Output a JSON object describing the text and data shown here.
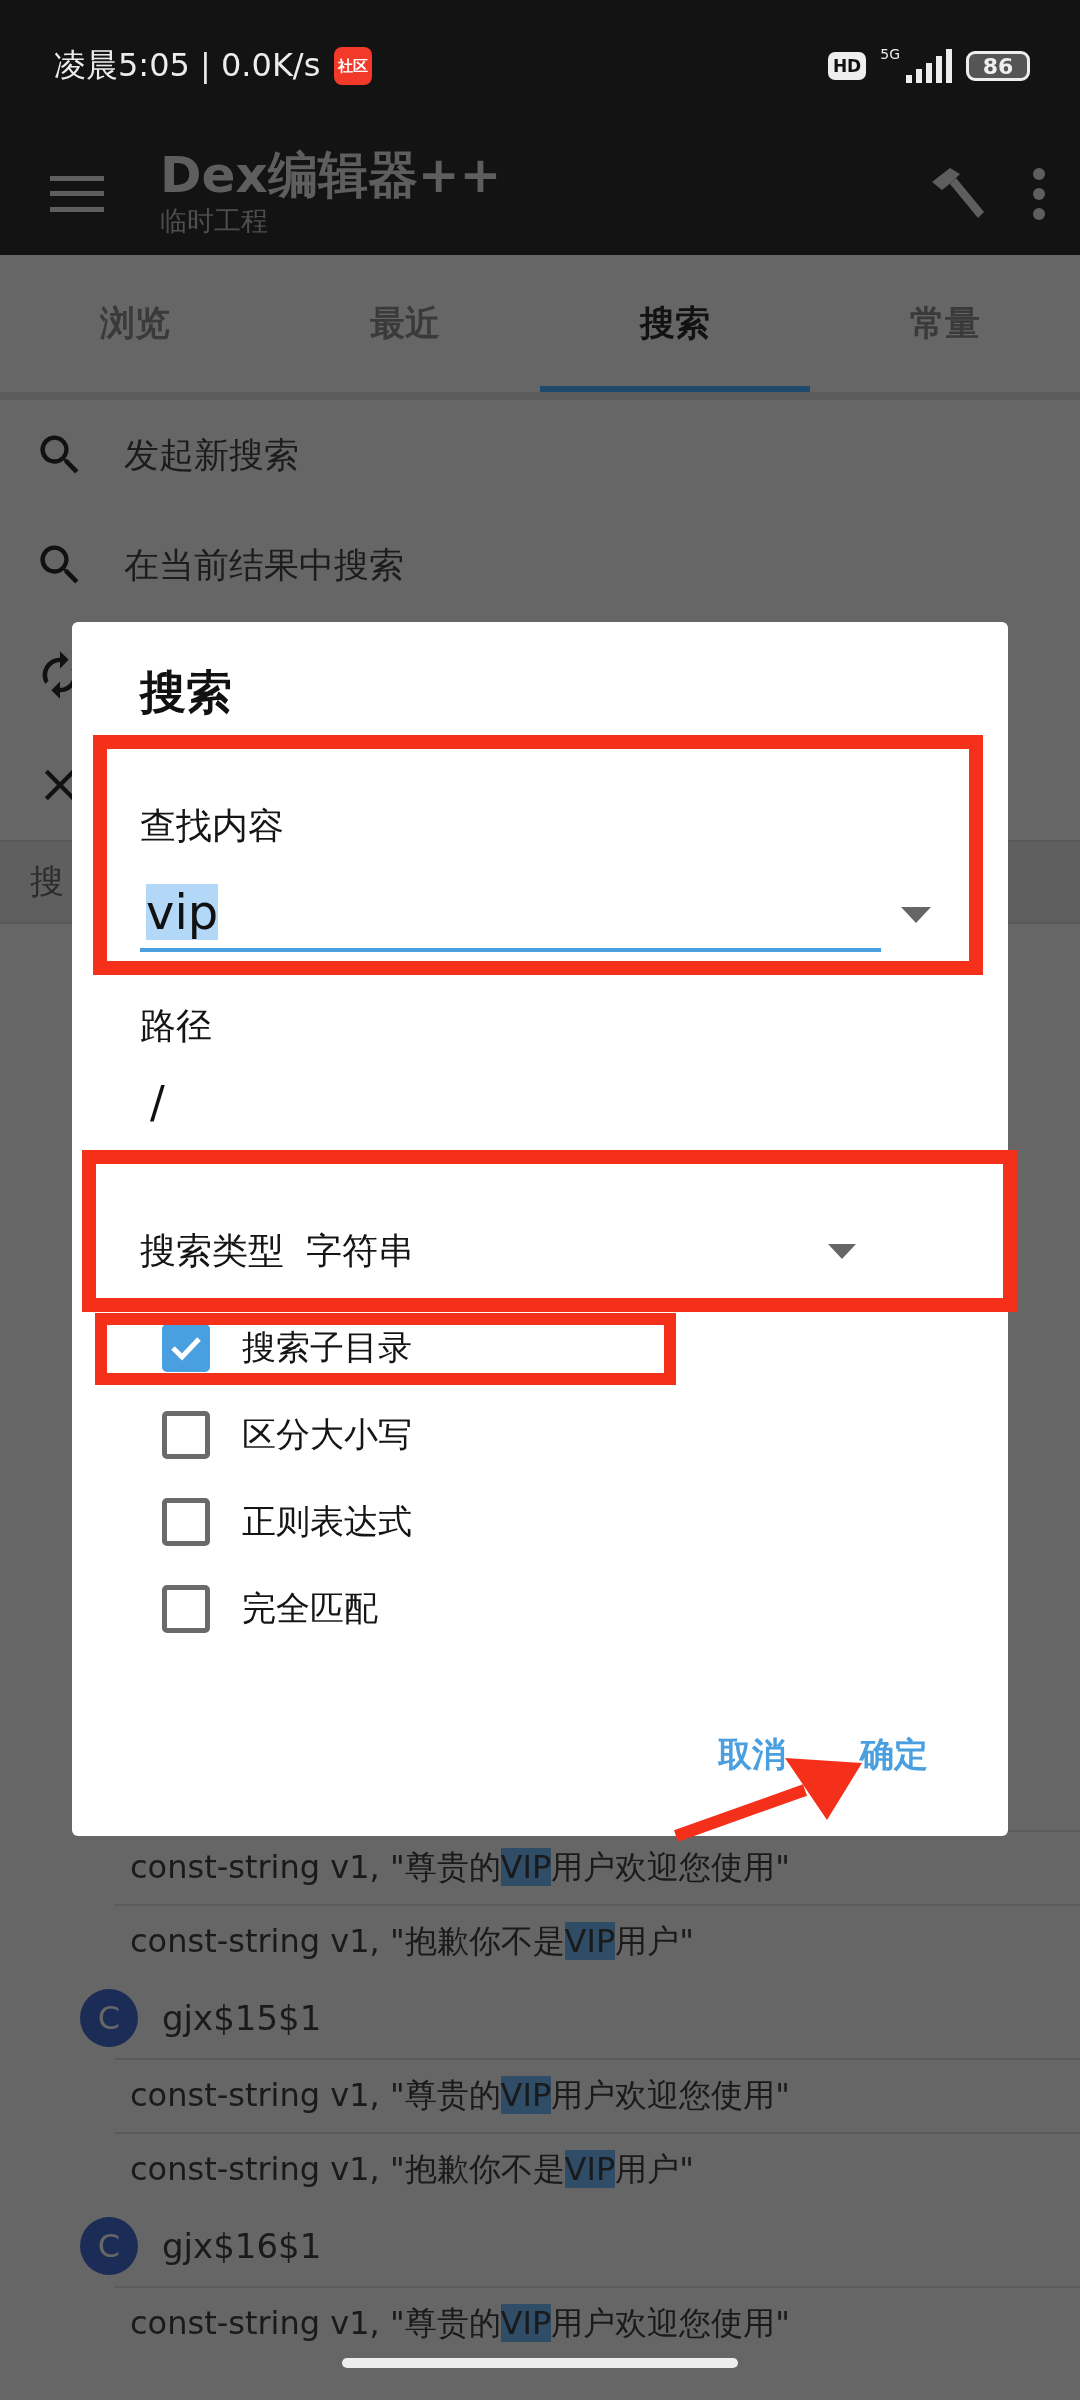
{
  "status_bar": {
    "time": "凌晨5:05 | 0.0K/s",
    "app_badge": "社区",
    "hd": "HD",
    "network": "5G",
    "battery": "86"
  },
  "app_bar": {
    "title": "Dex编辑器++",
    "subtitle": "临时工程"
  },
  "tabs": [
    {
      "label": "浏览",
      "selected": false
    },
    {
      "label": "最近",
      "selected": false
    },
    {
      "label": "搜索",
      "selected": true
    },
    {
      "label": "常量",
      "selected": false
    }
  ],
  "menu": [
    {
      "kind": "search",
      "label": "发起新搜索"
    },
    {
      "kind": "search",
      "label": "在当前结果中搜索"
    },
    {
      "kind": "refresh"
    },
    {
      "kind": "close"
    }
  ],
  "list_header": "搜",
  "results": [
    {
      "kind": "line",
      "before": "const-string v1, \"尊贵的",
      "match": "VIP",
      "after": "用户欢迎您使用\""
    },
    {
      "kind": "line",
      "before": "const-string v1, \"抱歉你不是",
      "match": "VIP",
      "after": "用户\""
    },
    {
      "kind": "class",
      "icon": "C",
      "name": "gjx$15$1"
    },
    {
      "kind": "line",
      "before": "const-string v1, \"尊贵的",
      "match": "VIP",
      "after": "用户欢迎您使用\""
    },
    {
      "kind": "line",
      "before": "const-string v1, \"抱歉你不是",
      "match": "VIP",
      "after": "用户\""
    },
    {
      "kind": "class",
      "icon": "C",
      "name": "gjx$16$1"
    },
    {
      "kind": "line",
      "before": "const-string v1, \"尊贵的",
      "match": "VIP",
      "after": "用户欢迎您使用\""
    }
  ],
  "dialog": {
    "title": "搜索",
    "find_label": "查找内容",
    "find_value": "vip",
    "find_value_selected": true,
    "path_label": "路径",
    "path_value": "/",
    "search_type": {
      "label": "搜索类型",
      "value": "字符串"
    },
    "options": [
      {
        "label": "搜索子目录",
        "checked": true
      },
      {
        "label": "区分大小写",
        "checked": false
      },
      {
        "label": "正则表达式",
        "checked": false
      },
      {
        "label": "完全匹配",
        "checked": false
      }
    ],
    "buttons": [
      "取消",
      "确定"
    ]
  }
}
